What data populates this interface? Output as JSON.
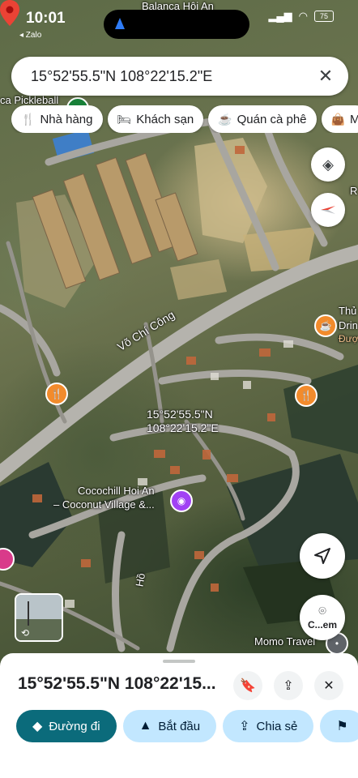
{
  "status_bar": {
    "time": "10:01",
    "back_app": "◂ Zalo",
    "battery": "75"
  },
  "map": {
    "top_place": "Balanca Hội An",
    "pickleball_label": "ca Pickleball",
    "street_label": "Võ Chí Công",
    "pin_label_line1": "15°52'55.5\"N",
    "pin_label_line2": "108°22'15.2\"E",
    "poi_cocochill_line1": "Cocochill Hoi An",
    "poi_cocochill_line2": "– Coconut Village &...",
    "poi_right_top": "Thủ",
    "poi_right_mid": "Drin",
    "poi_right_bot": "Đượ",
    "poi_edge_r": "R",
    "street_ho": "Hồ",
    "momo": "Momo Travel",
    "search_here_label": "C...em"
  },
  "search": {
    "query": "15°52'55.5\"N 108°22'15.2\"E"
  },
  "chips": [
    {
      "label": "Nhà hàng",
      "icon": "fork-knife-icon"
    },
    {
      "label": "Khách sạn",
      "icon": "bed-icon"
    },
    {
      "label": "Quán cà phê",
      "icon": "coffee-icon"
    },
    {
      "label": "M",
      "icon": "bag-icon"
    }
  ],
  "sheet": {
    "title": "15°52'55.5\"N 108°22'15...",
    "actions": [
      {
        "label": "Đường đi",
        "icon": "directions-icon"
      },
      {
        "label": "Bắt đầu",
        "icon": "navigate-arrow-icon"
      },
      {
        "label": "Chia sẻ",
        "icon": "share-icon"
      },
      {
        "label": "",
        "icon": "flag-icon"
      }
    ]
  },
  "colors": {
    "accent": "#0b6b7b",
    "pin": "#ea4335",
    "chip_bg": "#ffffff",
    "tonal": "#c2e7ff",
    "poi_orange": "#f28b2c",
    "poi_purple": "#a142f4"
  }
}
